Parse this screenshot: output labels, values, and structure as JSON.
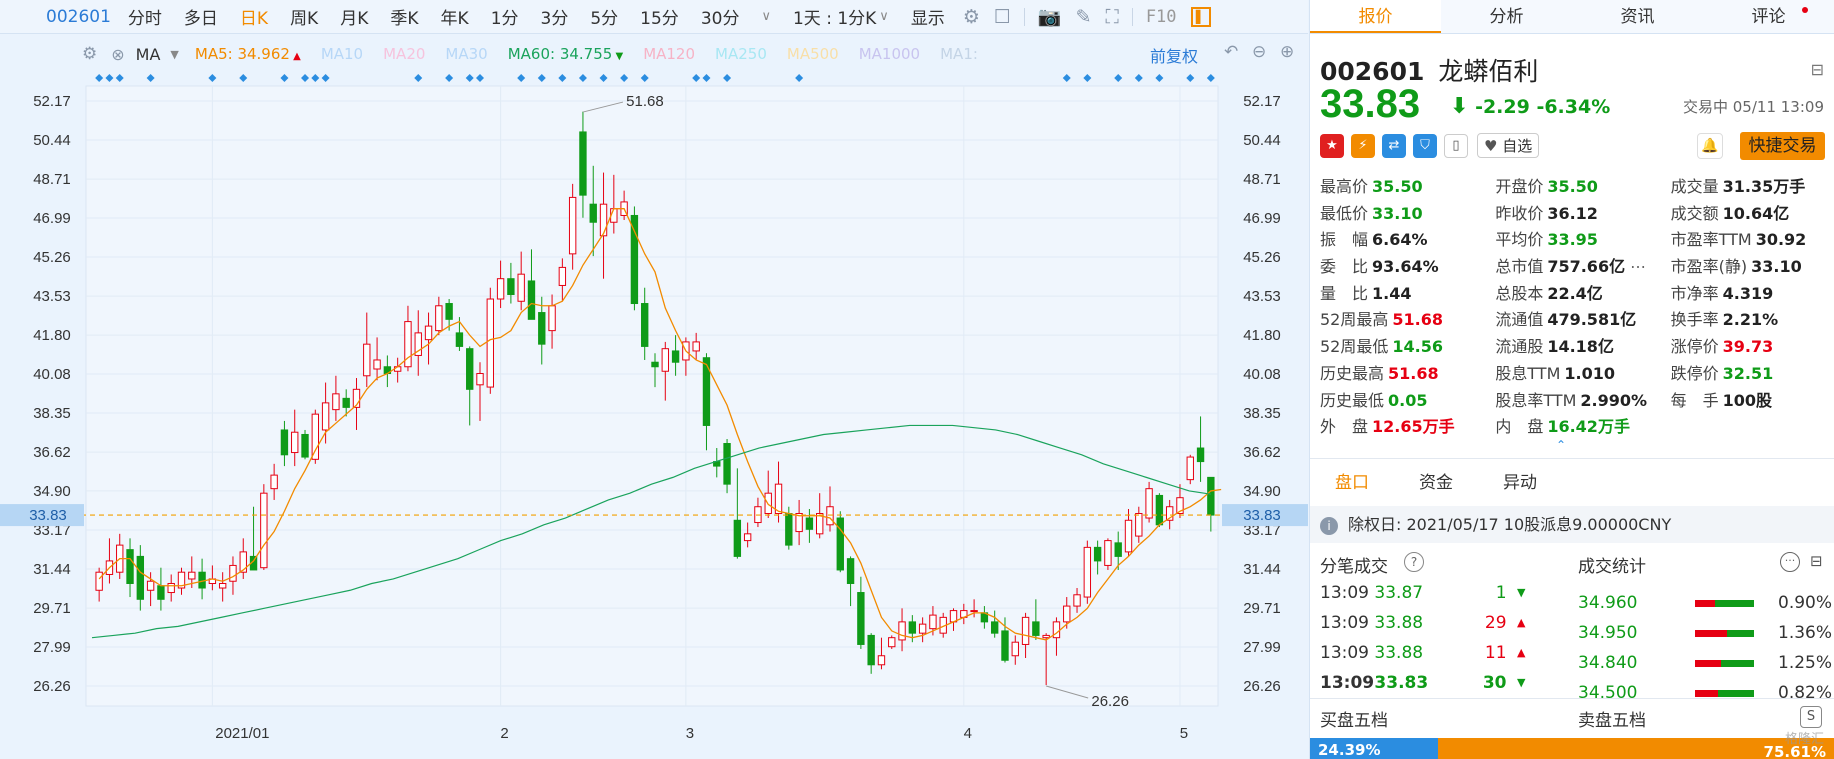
{
  "toolbar": {
    "code": "002601",
    "periods": [
      "分时",
      "多日",
      "日K",
      "周K",
      "月K",
      "季K",
      "年K",
      "1分",
      "3分",
      "5分",
      "15分",
      "30分"
    ],
    "active_period": "日K",
    "range_label": "1天 : 1分K",
    "display_label": "显示",
    "f10": "F10"
  },
  "ma_bar": {
    "ma_label": "MA",
    "items": [
      {
        "label": "MA5: 34.962",
        "color": "#f28b00",
        "arrow": "up"
      },
      {
        "label": "MA10",
        "color": "#b7d7f7"
      },
      {
        "label": "MA20",
        "color": "#f6c3dd"
      },
      {
        "label": "MA30",
        "color": "#b7d7f7"
      },
      {
        "label": "MA60: 34.755",
        "color": "#1aa35c",
        "arrow": "down"
      },
      {
        "label": "MA120",
        "color": "#f6b3c6"
      },
      {
        "label": "MA250",
        "color": "#a8e7f3"
      },
      {
        "label": "MA500",
        "color": "#f8dfa8"
      },
      {
        "label": "MA1000",
        "color": "#c8c4ef"
      },
      {
        "label": "MA1:",
        "color": "#c4d4e6"
      }
    ],
    "adjust_label": "前复权"
  },
  "chart_data": {
    "type": "candlestick",
    "y_ticks": [
      "52.17",
      "50.44",
      "48.71",
      "46.99",
      "45.26",
      "43.53",
      "41.80",
      "40.08",
      "38.35",
      "36.62",
      "34.90",
      "33.17",
      "31.44",
      "29.71",
      "27.99",
      "26.26"
    ],
    "ylim": [
      26.26,
      52.17
    ],
    "x_labels": [
      "2021/01",
      "2",
      "3",
      "4",
      "5"
    ],
    "current_price": "33.83",
    "high_label": "51.68",
    "low_label": "26.26",
    "candles": [
      [
        30.0,
        31.5,
        30.5,
        31.3
      ],
      [
        30.8,
        32.8,
        31.2,
        31.8
      ],
      [
        31.0,
        33.0,
        31.3,
        32.5
      ],
      [
        30.2,
        32.8,
        32.3,
        30.8
      ],
      [
        29.6,
        32.5,
        32.0,
        30.1
      ],
      [
        29.8,
        31.3,
        30.5,
        30.9
      ],
      [
        29.6,
        31.5,
        30.7,
        30.1
      ],
      [
        30.0,
        31.2,
        30.4,
        30.8
      ],
      [
        30.3,
        31.5,
        30.6,
        31.3
      ],
      [
        30.6,
        32.0,
        31.0,
        31.3
      ],
      [
        30.1,
        31.9,
        31.3,
        30.6
      ],
      [
        30.5,
        31.6,
        30.8,
        31.0
      ],
      [
        30.0,
        31.3,
        30.6,
        30.8
      ],
      [
        30.3,
        32.0,
        30.9,
        31.6
      ],
      [
        31.0,
        32.8,
        31.3,
        32.2
      ],
      [
        31.5,
        34.2,
        32.0,
        31.4
      ],
      [
        31.4,
        35.2,
        31.5,
        34.8
      ],
      [
        34.5,
        36.1,
        35.0,
        35.6
      ],
      [
        36.0,
        38.0,
        37.6,
        36.5
      ],
      [
        36.0,
        38.5,
        36.6,
        37.5
      ],
      [
        36.3,
        37.6,
        37.4,
        36.4
      ],
      [
        36.1,
        38.5,
        36.3,
        38.3
      ],
      [
        37.0,
        39.7,
        37.6,
        38.8
      ],
      [
        38.0,
        40.0,
        38.5,
        39.2
      ],
      [
        38.2,
        39.4,
        39.0,
        38.6
      ],
      [
        37.6,
        39.9,
        38.6,
        39.4
      ],
      [
        39.5,
        42.8,
        40.0,
        41.4
      ],
      [
        39.8,
        41.7,
        40.3,
        40.7
      ],
      [
        39.5,
        40.9,
        40.4,
        40.1
      ],
      [
        39.7,
        40.8,
        40.2,
        40.4
      ],
      [
        40.2,
        43.1,
        40.4,
        42.4
      ],
      [
        40.0,
        42.9,
        40.9,
        41.9
      ],
      [
        40.5,
        42.8,
        41.6,
        42.2
      ],
      [
        41.8,
        43.5,
        42.0,
        43.1
      ],
      [
        42.0,
        43.4,
        43.2,
        42.5
      ],
      [
        41.1,
        42.6,
        41.9,
        41.3
      ],
      [
        37.8,
        41.3,
        41.2,
        39.4
      ],
      [
        38.0,
        40.6,
        39.6,
        40.1
      ],
      [
        39.2,
        43.9,
        39.5,
        43.4
      ],
      [
        43.0,
        45.1,
        43.4,
        44.3
      ],
      [
        43.2,
        45.0,
        44.3,
        43.6
      ],
      [
        42.9,
        45.5,
        43.3,
        44.5
      ],
      [
        43.6,
        45.6,
        44.2,
        42.5
      ],
      [
        40.5,
        43.5,
        42.8,
        41.4
      ],
      [
        41.2,
        43.6,
        42.0,
        43.1
      ],
      [
        43.3,
        45.2,
        44.0,
        44.8
      ],
      [
        44.7,
        48.5,
        45.4,
        47.9
      ],
      [
        47.0,
        51.7,
        50.8,
        48.0
      ],
      [
        45.3,
        49.3,
        47.6,
        46.8
      ],
      [
        44.3,
        49.0,
        46.2,
        47.6
      ],
      [
        46.3,
        48.9,
        46.8,
        47.4
      ],
      [
        46.9,
        48.2,
        47.1,
        47.7
      ],
      [
        42.9,
        47.5,
        47.1,
        43.2
      ],
      [
        40.7,
        43.9,
        43.2,
        41.3
      ],
      [
        39.5,
        41.0,
        40.6,
        40.4
      ],
      [
        38.9,
        41.5,
        40.2,
        41.2
      ],
      [
        40.0,
        41.8,
        41.1,
        40.6
      ],
      [
        40.0,
        41.7,
        40.7,
        41.5
      ],
      [
        40.7,
        41.9,
        41.1,
        41.5
      ],
      [
        36.7,
        41.0,
        40.8,
        37.8
      ],
      [
        35.5,
        36.8,
        36.2,
        36.0
      ],
      [
        34.8,
        37.2,
        37.0,
        35.2
      ],
      [
        31.9,
        35.9,
        33.6,
        32.0
      ],
      [
        32.4,
        33.5,
        32.7,
        33.0
      ],
      [
        33.3,
        34.6,
        33.5,
        34.2
      ],
      [
        33.7,
        35.8,
        33.9,
        34.8
      ],
      [
        33.5,
        36.2,
        33.9,
        35.2
      ],
      [
        32.3,
        34.2,
        33.9,
        32.5
      ],
      [
        32.5,
        34.5,
        33.1,
        33.9
      ],
      [
        32.6,
        34.1,
        33.7,
        33.2
      ],
      [
        32.8,
        34.8,
        33.0,
        33.9
      ],
      [
        33.1,
        35.1,
        33.4,
        34.2
      ],
      [
        31.3,
        34.0,
        33.7,
        31.4
      ],
      [
        29.8,
        32.0,
        31.9,
        30.8
      ],
      [
        27.9,
        31.1,
        30.4,
        28.1
      ],
      [
        26.8,
        28.6,
        28.5,
        27.2
      ],
      [
        27.0,
        28.4,
        27.2,
        27.6
      ],
      [
        27.9,
        28.5,
        28.0,
        28.4
      ],
      [
        27.8,
        29.7,
        28.3,
        29.1
      ],
      [
        28.2,
        29.4,
        29.1,
        28.6
      ],
      [
        28.2,
        29.3,
        28.6,
        29.0
      ],
      [
        28.5,
        29.8,
        28.8,
        29.4
      ],
      [
        28.4,
        29.5,
        28.6,
        29.3
      ],
      [
        28.7,
        29.7,
        29.1,
        29.6
      ],
      [
        29.0,
        29.9,
        29.3,
        29.6
      ],
      [
        29.3,
        30.1,
        29.6,
        29.6
      ],
      [
        28.8,
        29.8,
        29.5,
        29.1
      ],
      [
        28.4,
        29.6,
        29.1,
        28.6
      ],
      [
        27.3,
        29.3,
        28.7,
        27.4
      ],
      [
        27.2,
        28.5,
        27.6,
        28.2
      ],
      [
        27.5,
        29.5,
        28.1,
        29.3
      ],
      [
        28.3,
        30.1,
        29.1,
        28.5
      ],
      [
        26.3,
        28.6,
        28.4,
        28.5
      ],
      [
        27.6,
        29.3,
        28.4,
        29.1
      ],
      [
        28.8,
        30.2,
        29.1,
        29.8
      ],
      [
        29.5,
        30.6,
        29.8,
        30.3
      ],
      [
        29.9,
        32.7,
        30.2,
        32.4
      ],
      [
        31.2,
        32.7,
        32.4,
        31.8
      ],
      [
        31.4,
        32.8,
        31.6,
        32.7
      ],
      [
        31.4,
        33.1,
        32.6,
        32.0
      ],
      [
        32.0,
        34.1,
        32.2,
        33.6
      ],
      [
        32.6,
        34.2,
        32.9,
        33.9
      ],
      [
        33.5,
        35.3,
        33.7,
        35.0
      ],
      [
        33.3,
        34.8,
        34.7,
        33.4
      ],
      [
        33.2,
        34.5,
        33.6,
        34.2
      ],
      [
        33.7,
        35.2,
        33.9,
        34.6
      ],
      [
        35.2,
        36.5,
        35.4,
        36.4
      ],
      [
        35.3,
        38.2,
        36.8,
        36.2
      ],
      [
        33.1,
        35.5,
        35.5,
        33.83
      ]
    ],
    "ma5": [
      31.0,
      31.5,
      31.9,
      31.9,
      31.3,
      31.0,
      30.7,
      30.7,
      30.7,
      30.8,
      30.9,
      31.0,
      30.9,
      31.1,
      31.4,
      31.8,
      32.5,
      33.1,
      34.0,
      35.0,
      35.8,
      36.7,
      37.5,
      37.9,
      38.3,
      38.7,
      39.4,
      39.9,
      40.1,
      40.4,
      40.8,
      41.1,
      41.4,
      41.9,
      42.2,
      42.4,
      41.8,
      41.3,
      41.6,
      41.7,
      42.0,
      42.8,
      43.2,
      43.1,
      43.1,
      43.3,
      44.0,
      44.9,
      45.6,
      46.3,
      47.4,
      47.4,
      46.4,
      45.4,
      44.6,
      43.0,
      42.0,
      41.1,
      40.7,
      40.5,
      39.6,
      38.7,
      37.4,
      36.2,
      35.1,
      34.3,
      34.0,
      33.9,
      33.8,
      33.8,
      33.8,
      33.7,
      33.2,
      32.6,
      31.7,
      30.5,
      29.3,
      28.7,
      28.5,
      28.4,
      28.5,
      28.7,
      28.9,
      29.1,
      29.3,
      29.5,
      29.5,
      29.3,
      28.9,
      28.6,
      28.5,
      28.4,
      28.3,
      28.6,
      29.0,
      29.3,
      29.7,
      30.4,
      31.0,
      31.6,
      32.0,
      32.5,
      32.9,
      33.4,
      33.7,
      34.0,
      34.2,
      34.5,
      34.9,
      34.962
    ],
    "ma60": [
      28.4,
      28.5,
      28.6,
      28.8,
      28.9,
      29.1,
      29.3,
      29.5,
      29.7,
      29.9,
      30.1,
      30.3,
      30.5,
      30.8,
      31.0,
      31.3,
      31.6,
      31.9,
      32.3,
      32.7,
      33.0,
      33.4,
      33.7,
      34.1,
      34.5,
      34.8,
      35.2,
      35.5,
      35.9,
      36.2,
      36.5,
      36.8,
      37.0,
      37.2,
      37.4,
      37.5,
      37.6,
      37.7,
      37.8,
      37.8,
      37.8,
      37.7,
      37.6,
      37.4,
      37.1,
      36.8,
      36.5,
      36.1,
      35.8,
      35.5,
      35.2,
      34.9,
      34.755
    ]
  },
  "right": {
    "tabs": [
      "报价",
      "分析",
      "资讯",
      "评论"
    ],
    "active_tab": "报价",
    "code": "002601",
    "name": "龙蟒佰利",
    "price": "33.83",
    "change": "-2.29",
    "pct": "-6.34%",
    "trade_status": "交易中 05/11 13:09",
    "watch_label": "自选",
    "quick_trade": "快捷交易",
    "quote_grid": [
      [
        {
          "l": "最高价",
          "v": "35.50",
          "c": "green"
        },
        {
          "l": "开盘价",
          "v": "35.50",
          "c": "green"
        },
        {
          "l": "成交量",
          "v": "31.35万手",
          "c": "dark"
        }
      ],
      [
        {
          "l": "最低价",
          "v": "33.10",
          "c": "green"
        },
        {
          "l": "昨收价",
          "v": "36.12",
          "c": "dark"
        },
        {
          "l": "成交额",
          "v": "10.64亿",
          "c": "dark"
        }
      ],
      [
        {
          "l": "振　幅",
          "v": "6.64%",
          "c": "dark"
        },
        {
          "l": "平均价",
          "v": "33.95",
          "c": "green"
        },
        {
          "l": "市盈率TTM",
          "v": "30.92",
          "c": "dark"
        }
      ],
      [
        {
          "l": "委　比",
          "v": "93.64%",
          "c": "dark"
        },
        {
          "l": "总市值",
          "v": "757.66亿",
          "c": "dark"
        },
        {
          "l": "市盈率(静)",
          "v": "33.10",
          "c": "dark"
        }
      ],
      [
        {
          "l": "量　比",
          "v": "1.44",
          "c": "dark"
        },
        {
          "l": "总股本",
          "v": "22.4亿",
          "c": "dark"
        },
        {
          "l": "市净率",
          "v": "4.319",
          "c": "dark"
        }
      ],
      [
        {
          "l": "52周最高",
          "v": "51.68",
          "c": "red"
        },
        {
          "l": "流通值",
          "v": "479.581亿",
          "c": "dark"
        },
        {
          "l": "换手率",
          "v": "2.21%",
          "c": "dark"
        }
      ],
      [
        {
          "l": "52周最低",
          "v": "14.56",
          "c": "green"
        },
        {
          "l": "流通股",
          "v": "14.18亿",
          "c": "dark"
        },
        {
          "l": "涨停价",
          "v": "39.73",
          "c": "red"
        }
      ],
      [
        {
          "l": "历史最高",
          "v": "51.68",
          "c": "red"
        },
        {
          "l": "股息TTM",
          "v": "1.010",
          "c": "dark"
        },
        {
          "l": "跌停价",
          "v": "32.51",
          "c": "green"
        }
      ],
      [
        {
          "l": "历史最低",
          "v": "0.05",
          "c": "green"
        },
        {
          "l": "股息率TTM",
          "v": "2.990%",
          "c": "dark"
        },
        {
          "l": "每　手",
          "v": "100股",
          "c": "dark"
        }
      ],
      [
        {
          "l": "外　盘",
          "v": "12.65万手",
          "c": "red"
        },
        {
          "l": "内　盘",
          "v": "16.42万手",
          "c": "green"
        },
        {
          "l": "",
          "v": "",
          "c": "dark"
        }
      ]
    ],
    "panel_tabs": [
      "盘口",
      "资金",
      "异动"
    ],
    "active_panel": "盘口",
    "notice": "除权日: 2021/05/17  10股派息9.00000CNY",
    "trades_title": "分笔成交",
    "stats_title": "成交统计",
    "trades": [
      {
        "t": "13:09",
        "p": "33.87",
        "q": "1",
        "dir": "down"
      },
      {
        "t": "13:09",
        "p": "33.88",
        "q": "29",
        "dir": "up"
      },
      {
        "t": "13:09",
        "p": "33.88",
        "q": "11",
        "dir": "up"
      },
      {
        "t": "13:09",
        "p": "33.83",
        "q": "30",
        "dir": "down"
      }
    ],
    "stats": [
      {
        "p": "34.960",
        "r": 0.35,
        "v": "0.90%"
      },
      {
        "p": "34.950",
        "r": 0.55,
        "v": "1.36%"
      },
      {
        "p": "34.840",
        "r": 0.45,
        "v": "1.25%"
      },
      {
        "p": "34.500",
        "r": 0.4,
        "v": "0.82%"
      }
    ],
    "buy5": "买盘五档",
    "sell5": "卖盘五档",
    "buy_pct": "24.39%",
    "sell_pct": "75.61%",
    "buy_ratio": 0.2439,
    "watermark": "格隆汇"
  }
}
